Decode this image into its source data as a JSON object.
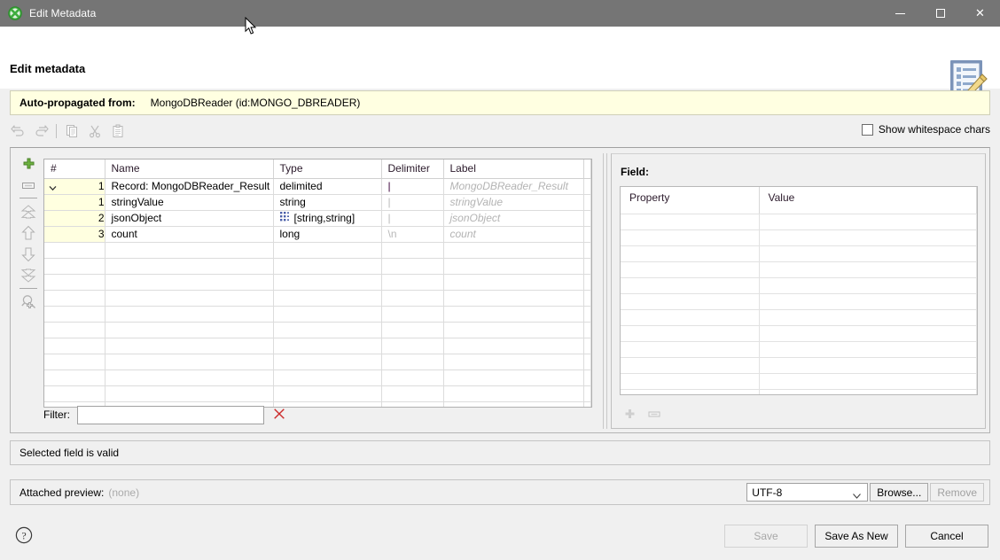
{
  "window": {
    "title": "Edit Metadata",
    "app_icon": "clover-green-icon",
    "minimize_label": "Minimize",
    "maximize_label": "Maximize",
    "close_label": "Close"
  },
  "header": {
    "page_title": "Edit metadata",
    "icon": "metadata-edit-icon"
  },
  "auto_propagated": {
    "label": "Auto-propagated from:",
    "value": "MongoDBReader (id:MONGO_DBREADER)"
  },
  "edit_toolbar": {
    "buttons": [
      {
        "name": "undo-icon",
        "tooltip": "Undo",
        "enabled": false
      },
      {
        "name": "redo-icon",
        "tooltip": "Redo",
        "enabled": false
      },
      {
        "name": "copy-icon",
        "tooltip": "Copy",
        "enabled": false
      },
      {
        "name": "cut-icon",
        "tooltip": "Cut",
        "enabled": false
      },
      {
        "name": "paste-icon",
        "tooltip": "Paste",
        "enabled": false
      }
    ]
  },
  "show_whitespace": {
    "label": "Show whitespace chars",
    "checked": false
  },
  "side_toolbar": {
    "buttons": [
      {
        "name": "add-field-button",
        "icon": "green-plus-icon"
      },
      {
        "name": "remove-field-button",
        "icon": "gray-minus-box-icon"
      },
      {
        "name": "move-to-top-button",
        "icon": "double-up-arrow-icon"
      },
      {
        "name": "move-up-button",
        "icon": "up-arrow-icon"
      },
      {
        "name": "move-down-button",
        "icon": "down-arrow-icon"
      },
      {
        "name": "move-to-bottom-button",
        "icon": "double-down-arrow-icon"
      },
      {
        "name": "zoom-field-button",
        "icon": "magnifier-plus-icon"
      }
    ]
  },
  "field_table": {
    "columns": [
      "#",
      "Name",
      "Type",
      "Delimiter",
      "Label",
      ""
    ],
    "rows": [
      {
        "num": "1",
        "expander": "chevron-down-icon",
        "name": "Record: MongoDBReader_Result",
        "type": "delimited",
        "type_icon": "",
        "delimiter": "|",
        "delimiter_strong": true,
        "label": "MongoDBReader_Result",
        "is_record": true
      },
      {
        "num": "1",
        "expander": "",
        "name": "stringValue",
        "type": "string",
        "type_icon": "",
        "delimiter": "|",
        "delimiter_strong": false,
        "label": "stringValue",
        "is_record": false
      },
      {
        "num": "2",
        "expander": "",
        "name": "jsonObject",
        "type": "[string,string]",
        "type_icon": "map-grid-icon",
        "delimiter": "|",
        "delimiter_strong": false,
        "label": "jsonObject",
        "is_record": false
      },
      {
        "num": "3",
        "expander": "",
        "name": "count",
        "type": "long",
        "type_icon": "",
        "delimiter": "\\n",
        "delimiter_strong": false,
        "label": "count",
        "is_record": false
      }
    ],
    "empty_row_count": 11
  },
  "filter": {
    "label": "Filter:",
    "value": "",
    "placeholder": "",
    "clear_icon": "red-x-icon"
  },
  "field_detail": {
    "title": "Field:",
    "columns": [
      "Property",
      "Value"
    ],
    "rows": [],
    "empty_row_count": 12,
    "buttons": [
      {
        "name": "add-property-button",
        "icon": "gray-plus-icon"
      },
      {
        "name": "remove-property-button",
        "icon": "gray-minus-icon"
      }
    ]
  },
  "status": {
    "message": "Selected field is valid"
  },
  "attached_preview": {
    "label": "Attached preview:",
    "value": "(none)",
    "encoding": "UTF-8",
    "encoding_options": [
      "UTF-8"
    ],
    "browse_label": "Browse...",
    "remove_label": "Remove",
    "remove_enabled": false
  },
  "footer": {
    "help_icon": "question-mark-icon",
    "buttons": [
      {
        "name": "save-button",
        "label": "Save",
        "enabled": false
      },
      {
        "name": "save-as-new-button",
        "label": "Save As New",
        "enabled": true
      },
      {
        "name": "cancel-button",
        "label": "Cancel",
        "enabled": true
      }
    ]
  },
  "colors": {
    "titlebar": "#757575",
    "autoprop_bg": "#ffffe1",
    "row_num_bg": "#ffffe0",
    "accent_green": "#4caf50",
    "clear_red": "#cc2b2b"
  }
}
